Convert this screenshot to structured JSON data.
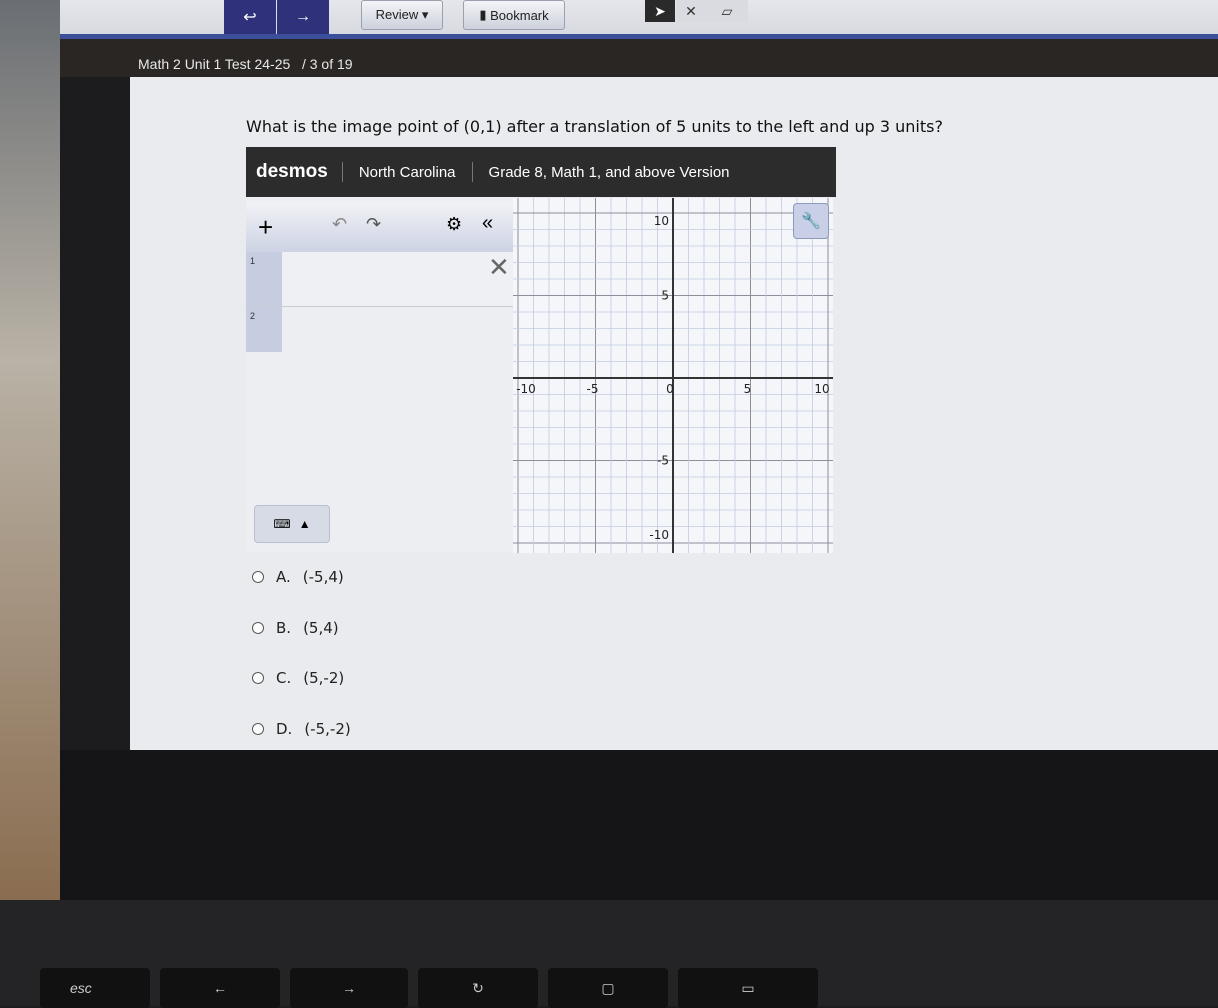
{
  "toolbar": {
    "back_icon": "hand-pointer-back",
    "forward_icon": "arrow-right",
    "review_label": "Review ▾",
    "bookmark_label": "Bookmark",
    "tools": [
      "pointer",
      "close",
      "note"
    ]
  },
  "header": {
    "test_title": "Math 2 Unit 1 Test 24-25",
    "progress": "/ 3 of 19"
  },
  "question": "What is the image point of (0,1) after a translation of 5 units to the left and up 3 units?",
  "desmos": {
    "logo": "desmos",
    "state": "North Carolina",
    "version": "Grade 8, Math 1, and above Version",
    "rows": [
      "1",
      "2"
    ]
  },
  "chart_data": {
    "type": "scatter",
    "xlim": [
      -10,
      10
    ],
    "ylim": [
      -10,
      10
    ],
    "grid": true,
    "x_ticks": [
      "-10",
      "-5",
      "0",
      "5",
      "10"
    ],
    "y_ticks": [
      "10",
      "5",
      "-5",
      "-10"
    ],
    "points": []
  },
  "choices": [
    {
      "letter": "A.",
      "text": "(-5,4)"
    },
    {
      "letter": "B.",
      "text": "(5,4)"
    },
    {
      "letter": "C.",
      "text": "(5,-2)"
    },
    {
      "letter": "D.",
      "text": "(-5,-2)"
    }
  ],
  "keyboard": {
    "esc": "esc"
  }
}
